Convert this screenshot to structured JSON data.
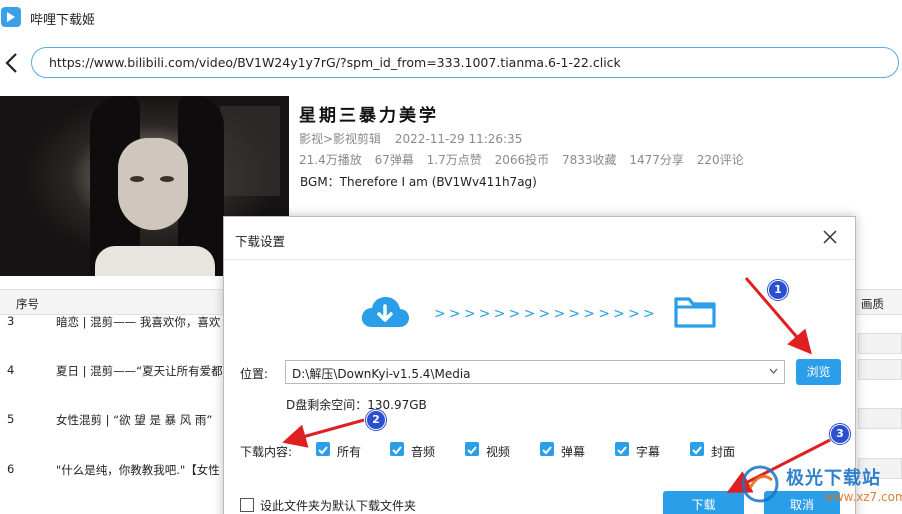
{
  "app": {
    "title": "哔哩下载姬"
  },
  "url_bar": {
    "value": "https://www.bilibili.com/video/BV1W24y1y7rG/?spm_id_from=333.1007.tianma.6-1-22.click"
  },
  "video": {
    "title": "星期三暴力美学",
    "category": "影视>影视剪辑",
    "date": "2022-11-29 11:26:35",
    "stats": [
      "21.4万播放",
      "67弹幕",
      "1.7万点赞",
      "2066投币",
      "7833收藏",
      "1477分享",
      "220评论"
    ],
    "bgm": "BGM：Therefore I am (BV1Wv411h7ag)"
  },
  "list": {
    "columns": {
      "index": "序号",
      "quality": "画质"
    },
    "rows": [
      {
        "index": "3",
        "title": "暗恋 | 混剪—— 我喜欢你，喜欢"
      },
      {
        "index": "4",
        "title": "夏日 | 混剪——“夏天让所有爱都"
      },
      {
        "index": "5",
        "title": "女性混剪 | “欲 望 是 暴 风 雨”"
      },
      {
        "index": "6",
        "title": "\"什么是纯，你教教我吧.\"【女性"
      }
    ]
  },
  "dialog": {
    "title": "下载设置",
    "arrows": ">>>>>>>>>>>>>>>",
    "location_label": "位置:",
    "location_value": "D:\\解压\\DownKyi-v1.5.4\\Media",
    "browse_label": "浏览",
    "free_space": "D盘剩余空间：130.97GB",
    "content_label": "下载内容:",
    "options": [
      {
        "label": "所有",
        "checked": true
      },
      {
        "label": "音频",
        "checked": true
      },
      {
        "label": "视频",
        "checked": true
      },
      {
        "label": "弹幕",
        "checked": true
      },
      {
        "label": "字幕",
        "checked": true
      },
      {
        "label": "封面",
        "checked": true
      }
    ],
    "default_folder_label": "设此文件夹为默认下载文件夹",
    "download_label": "下载",
    "cancel_label": "取消"
  },
  "annotations": {
    "badges": [
      "1",
      "2",
      "3"
    ],
    "color": "#e02020"
  },
  "watermark": {
    "text": "极光下载站",
    "url": "www.xz7.com"
  },
  "colors": {
    "accent": "#2a9ee8",
    "badge": "#2a4fd0"
  }
}
